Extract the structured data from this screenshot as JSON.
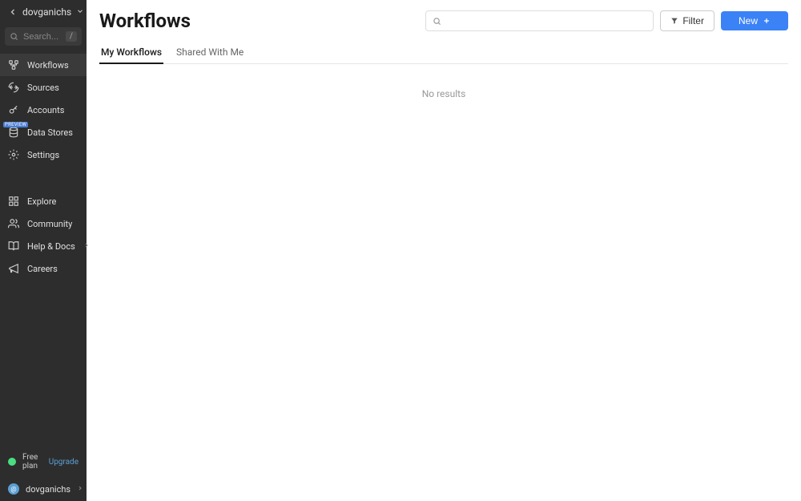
{
  "workspace": {
    "name": "dovganichs"
  },
  "sidebar": {
    "search_placeholder": "Search...",
    "search_kbd": "/",
    "nav_primary": [
      {
        "label": "Workflows",
        "icon": "workflows"
      },
      {
        "label": "Sources",
        "icon": "sources"
      },
      {
        "label": "Accounts",
        "icon": "accounts"
      },
      {
        "label": "Data Stores",
        "icon": "data-stores",
        "badge": "PREVIEW"
      },
      {
        "label": "Settings",
        "icon": "settings"
      }
    ],
    "nav_secondary": [
      {
        "label": "Explore",
        "icon": "explore"
      },
      {
        "label": "Community",
        "icon": "community"
      },
      {
        "label": "Help & Docs",
        "icon": "help",
        "chevron": true
      },
      {
        "label": "Careers",
        "icon": "careers"
      }
    ]
  },
  "footer": {
    "plan_label": "Free plan",
    "upgrade_label": "Upgrade",
    "user_name": "dovganichs",
    "avatar_letter": "@"
  },
  "main": {
    "title": "Workflows",
    "filter_label": "Filter",
    "new_label": "New",
    "tabs": [
      {
        "label": "My Workflows",
        "active": true
      },
      {
        "label": "Shared With Me",
        "active": false
      }
    ],
    "empty_text": "No results"
  }
}
